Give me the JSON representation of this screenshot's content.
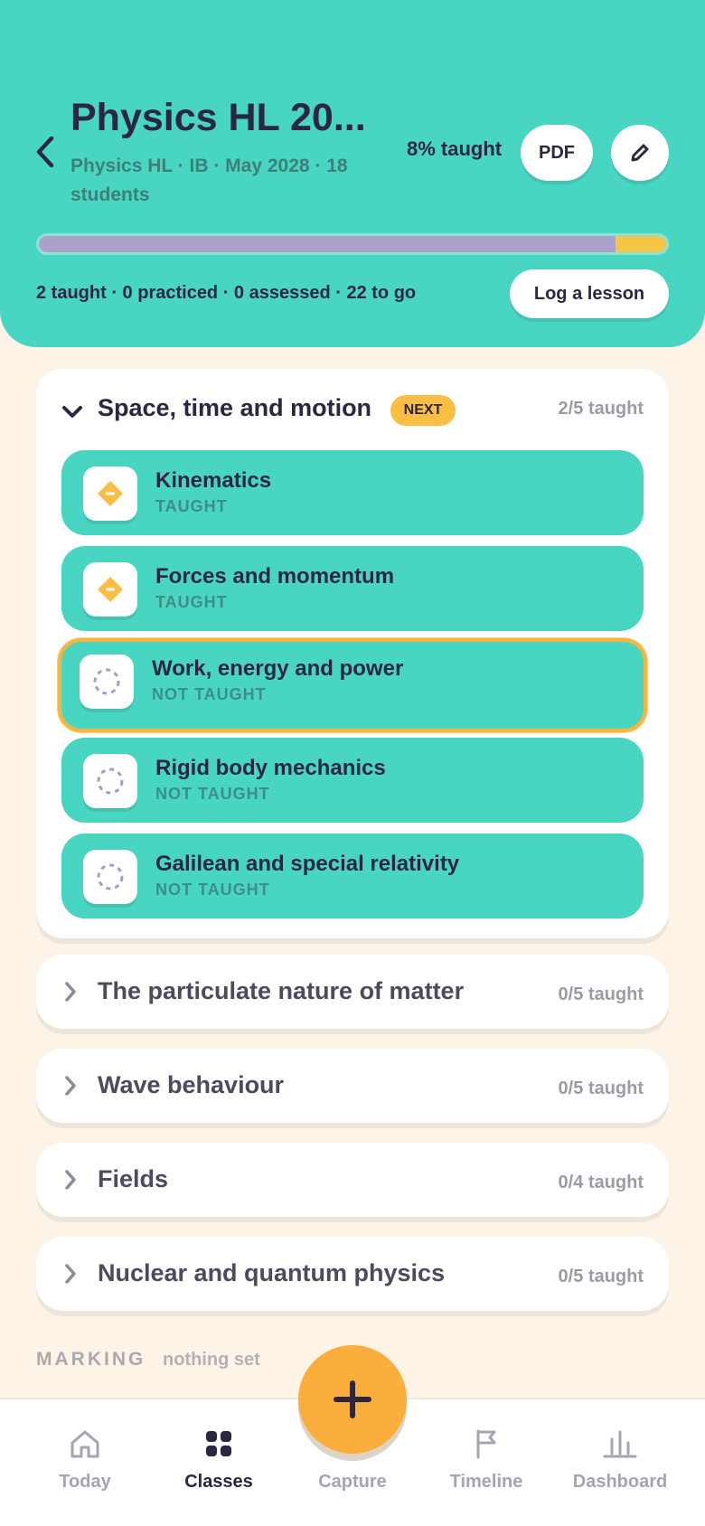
{
  "header": {
    "title": "Physics HL 20...",
    "subtitle": "Physics HL · IB · May 2028 · 18 students",
    "percent_label": "8% taught",
    "progress_fraction": 0.92,
    "pdf_label": "PDF",
    "stats": "2 taught · 0 practiced · 0 assessed · 22 to go",
    "log_label": "Log a lesson"
  },
  "open_section": {
    "title": "Space, time and motion",
    "badge": "NEXT",
    "count": "2/5 taught",
    "topics": [
      {
        "name": "Kinematics",
        "status": "TAUGHT",
        "icon": "taught-diamond-icon"
      },
      {
        "name": "Forces and momentum",
        "status": "TAUGHT",
        "icon": "taught-diamond-icon"
      },
      {
        "name": "Work, energy and power",
        "status": "NOT TAUGHT",
        "icon": "dashed-circle-icon",
        "current": true
      },
      {
        "name": "Rigid body mechanics",
        "status": "NOT TAUGHT",
        "icon": "dashed-circle-icon"
      },
      {
        "name": "Galilean and special relativity",
        "status": "NOT TAUGHT",
        "icon": "dashed-circle-icon"
      }
    ]
  },
  "sections": [
    {
      "title": "The particulate nature of matter",
      "count": "0/5 taught"
    },
    {
      "title": "Wave behaviour",
      "count": "0/5 taught"
    },
    {
      "title": "Fields",
      "count": "0/4 taught"
    },
    {
      "title": "Nuclear and quantum physics",
      "count": "0/5 taught"
    }
  ],
  "marking": {
    "label": "MARKING",
    "value": "nothing set"
  },
  "nav": [
    {
      "label": "Today",
      "icon": "home-icon"
    },
    {
      "label": "Classes",
      "icon": "grid-icon",
      "active": true
    },
    {
      "label": "Capture",
      "icon": "plus-icon"
    },
    {
      "label": "Timeline",
      "icon": "flag-icon"
    },
    {
      "label": "Dashboard",
      "icon": "bar-chart-icon"
    }
  ],
  "colors": {
    "header": "#48D6C2",
    "background": "#FDF3E7",
    "accent": "#F9BE43",
    "ink": "#2B2740",
    "progress_track": "#ABA2CC"
  }
}
